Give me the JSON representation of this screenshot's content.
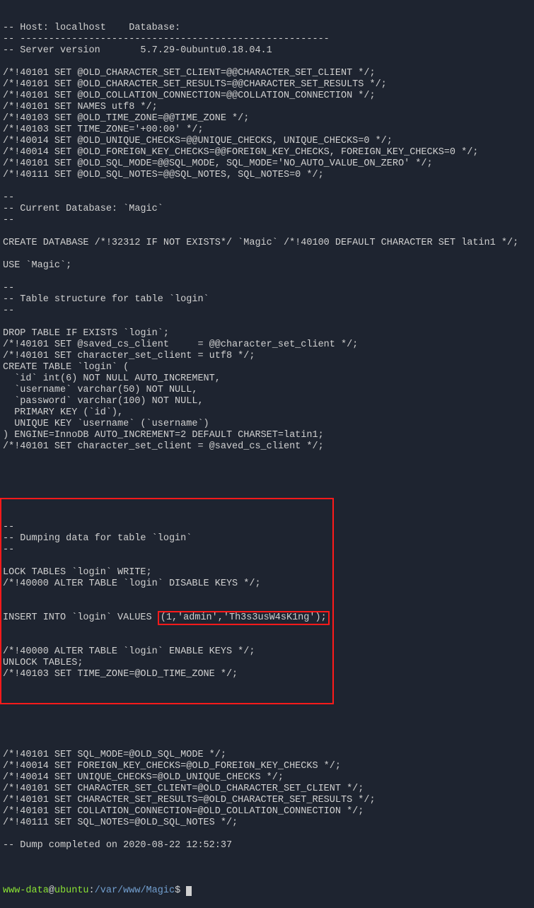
{
  "lines": [
    "-- Host: localhost    Database:",
    "-- ------------------------------------------------------",
    "-- Server version       5.7.29-0ubuntu0.18.04.1",
    "",
    "/*!40101 SET @OLD_CHARACTER_SET_CLIENT=@@CHARACTER_SET_CLIENT */;",
    "/*!40101 SET @OLD_CHARACTER_SET_RESULTS=@@CHARACTER_SET_RESULTS */;",
    "/*!40101 SET @OLD_COLLATION_CONNECTION=@@COLLATION_CONNECTION */;",
    "/*!40101 SET NAMES utf8 */;",
    "/*!40103 SET @OLD_TIME_ZONE=@@TIME_ZONE */;",
    "/*!40103 SET TIME_ZONE='+00:00' */;",
    "/*!40014 SET @OLD_UNIQUE_CHECKS=@@UNIQUE_CHECKS, UNIQUE_CHECKS=0 */;",
    "/*!40014 SET @OLD_FOREIGN_KEY_CHECKS=@@FOREIGN_KEY_CHECKS, FOREIGN_KEY_CHECKS=0 */;",
    "/*!40101 SET @OLD_SQL_MODE=@@SQL_MODE, SQL_MODE='NO_AUTO_VALUE_ON_ZERO' */;",
    "/*!40111 SET @OLD_SQL_NOTES=@@SQL_NOTES, SQL_NOTES=0 */;",
    "",
    "--",
    "-- Current Database: `Magic`",
    "--",
    "",
    "CREATE DATABASE /*!32312 IF NOT EXISTS*/ `Magic` /*!40100 DEFAULT CHARACTER SET latin1 */;",
    "",
    "USE `Magic`;",
    "",
    "--",
    "-- Table structure for table `login`",
    "--",
    "",
    "DROP TABLE IF EXISTS `login`;",
    "/*!40101 SET @saved_cs_client     = @@character_set_client */;",
    "/*!40101 SET character_set_client = utf8 */;",
    "CREATE TABLE `login` (",
    "  `id` int(6) NOT NULL AUTO_INCREMENT,",
    "  `username` varchar(50) NOT NULL,",
    "  `password` varchar(100) NOT NULL,",
    "  PRIMARY KEY (`id`),",
    "  UNIQUE KEY `username` (`username`)",
    ") ENGINE=InnoDB AUTO_INCREMENT=2 DEFAULT CHARSET=latin1;",
    "/*!40101 SET character_set_client = @saved_cs_client */;",
    ""
  ],
  "redbox_lines": [
    "--",
    "-- Dumping data for table `login`",
    "--",
    "",
    "LOCK TABLES `login` WRITE;",
    "/*!40000 ALTER TABLE `login` DISABLE KEYS */;"
  ],
  "insert_line": {
    "prefix": "INSERT INTO `login` VALUES ",
    "highlight": "(1,'admin','Th3s3usW4sK1ng');"
  },
  "redbox_after": [
    "/*!40000 ALTER TABLE `login` ENABLE KEYS */;",
    "UNLOCK TABLES;",
    "/*!40103 SET TIME_ZONE=@OLD_TIME_ZONE */;"
  ],
  "after_lines": [
    "",
    "/*!40101 SET SQL_MODE=@OLD_SQL_MODE */;",
    "/*!40014 SET FOREIGN_KEY_CHECKS=@OLD_FOREIGN_KEY_CHECKS */;",
    "/*!40014 SET UNIQUE_CHECKS=@OLD_UNIQUE_CHECKS */;",
    "/*!40101 SET CHARACTER_SET_CLIENT=@OLD_CHARACTER_SET_CLIENT */;",
    "/*!40101 SET CHARACTER_SET_RESULTS=@OLD_CHARACTER_SET_RESULTS */;",
    "/*!40101 SET COLLATION_CONNECTION=@OLD_COLLATION_CONNECTION */;",
    "/*!40111 SET SQL_NOTES=@OLD_SQL_NOTES */;",
    "",
    "-- Dump completed on 2020-08-22 12:52:37"
  ],
  "prompt": {
    "user": "www-data",
    "at": "@",
    "host": "ubuntu",
    "colon": ":",
    "path": "/var/www/Magic",
    "dollar": "$"
  }
}
